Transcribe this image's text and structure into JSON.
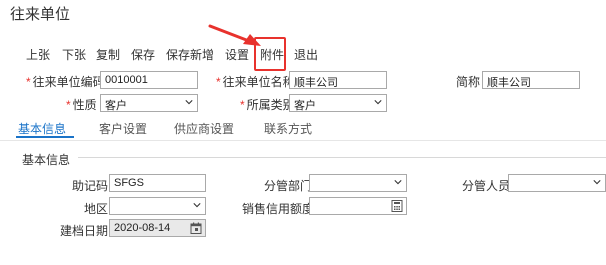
{
  "page": {
    "title": "往来单位"
  },
  "toolbar": {
    "items": [
      "上张",
      "下张",
      "复制",
      "保存",
      "保存新增",
      "设置",
      "附件",
      "退出"
    ]
  },
  "form": {
    "code_label": "往来单位编码",
    "code_value": "0010001",
    "name_label": "往来单位名称",
    "name_value": "顺丰公司",
    "short_label": "简称",
    "short_value": "顺丰公司",
    "nature_label": "性质",
    "nature_value": "客户",
    "category_label": "所属类别",
    "category_value": "客户"
  },
  "tabs": [
    "基本信息",
    "客户设置",
    "供应商设置",
    "联系方式"
  ],
  "basic": {
    "section_title": "基本信息",
    "mnemonic_label": "助记码",
    "mnemonic_value": "SFGS",
    "dept_label": "分管部门",
    "dept_value": "",
    "person_label": "分管人员",
    "person_value": "",
    "region_label": "地区",
    "region_value": "",
    "credit_label": "销售信用额度",
    "credit_value": "",
    "date_label": "建档日期",
    "date_value": "2020-08-14"
  },
  "colors": {
    "accent": "#1a73c8",
    "required": "#e8322d",
    "arrow": "#e8322d"
  }
}
